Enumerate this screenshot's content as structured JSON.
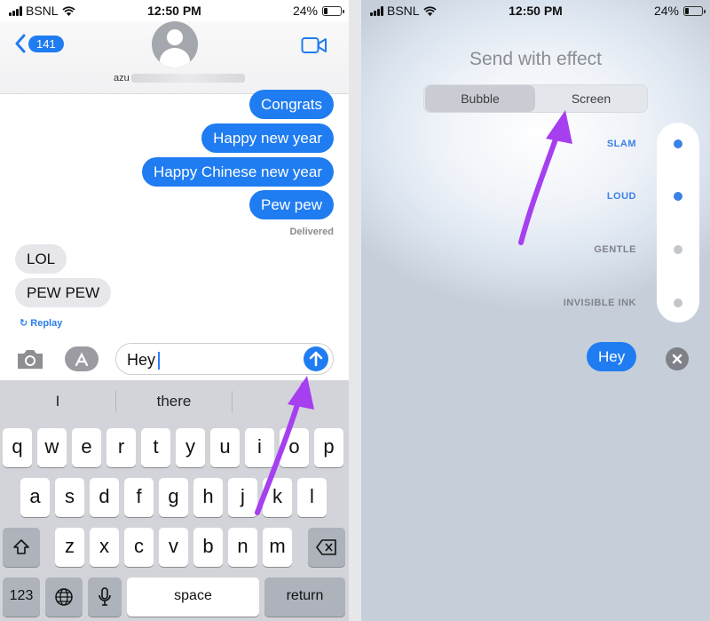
{
  "status": {
    "carrier": "BSNL",
    "time": "12:50 PM",
    "battery": "24%"
  },
  "left": {
    "back_count": "141",
    "contact_prefix": "azu",
    "messages": [
      {
        "text": "Congrats",
        "dir": "out"
      },
      {
        "text": "Happy new year",
        "dir": "out"
      },
      {
        "text": "Happy Chinese new year",
        "dir": "out"
      },
      {
        "text": "Pew pew",
        "dir": "out"
      },
      {
        "text": "LOL",
        "dir": "in"
      },
      {
        "text": "PEW PEW",
        "dir": "in"
      }
    ],
    "delivered": "Delivered",
    "replay": "Replay",
    "input_text": "Hey",
    "suggestions": [
      "I",
      "there",
      ""
    ],
    "keyboard": {
      "row1": [
        "q",
        "w",
        "e",
        "r",
        "t",
        "y",
        "u",
        "i",
        "o",
        "p"
      ],
      "row2": [
        "a",
        "s",
        "d",
        "f",
        "g",
        "h",
        "j",
        "k",
        "l"
      ],
      "row3": [
        "z",
        "x",
        "c",
        "v",
        "b",
        "n",
        "m"
      ],
      "numbers_key": "123",
      "space_key": "space",
      "return_key": "return"
    }
  },
  "right": {
    "title": "Send with effect",
    "tabs": [
      "Bubble",
      "Screen"
    ],
    "effects": [
      "SLAM",
      "LOUD",
      "GENTLE",
      "INVISIBLE INK"
    ],
    "message": "Hey"
  },
  "colors": {
    "accent": "#1f7cf1",
    "arrow": "#a63ff0",
    "label_blue": "#3b82e6",
    "label_gray": "#808389"
  },
  "icons": [
    "signal-icon",
    "wifi-icon",
    "battery-icon",
    "back-chevron-icon",
    "avatar-icon",
    "video-camera-icon",
    "replay-icon",
    "camera-icon",
    "app-store-icon",
    "send-arrow-icon",
    "shift-icon",
    "backspace-icon",
    "globe-icon",
    "microphone-icon",
    "close-icon"
  ]
}
